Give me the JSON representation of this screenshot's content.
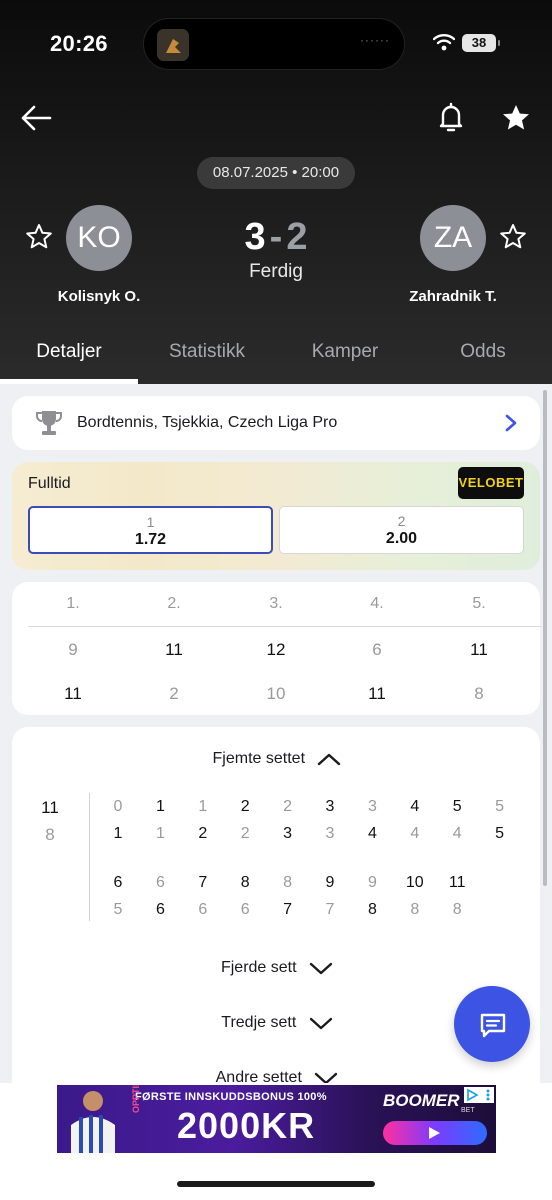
{
  "status_bar": {
    "time": "20:26",
    "battery": "38",
    "island_dots": "······"
  },
  "match": {
    "date": "08.07.2025 • 20:00",
    "home": {
      "initials": "KO",
      "name": "Kolisnyk O.",
      "score": "3"
    },
    "away": {
      "initials": "ZA",
      "name": "Zahradnik T.",
      "score": "2"
    },
    "dash": "-",
    "status": "Ferdig"
  },
  "tabs": [
    {
      "label": "Detaljer",
      "active": true
    },
    {
      "label": "Statistikk"
    },
    {
      "label": "Kamper"
    },
    {
      "label": "Odds"
    }
  ],
  "league": {
    "label": "Bordtennis, Tsjekkia, Czech Liga Pro"
  },
  "odds": {
    "title": "Fulltid",
    "bookmaker": "VELOBET",
    "home": {
      "label": "1",
      "value": "1.72"
    },
    "away": {
      "label": "2",
      "value": "2.00"
    }
  },
  "sets": {
    "headers": [
      "1.",
      "2.",
      "3.",
      "4.",
      "5."
    ],
    "home": [
      "9",
      "11",
      "12",
      "6",
      "11"
    ],
    "away": [
      "11",
      "2",
      "10",
      "11",
      "8"
    ]
  },
  "detail": {
    "current_set": "Fjemte settet",
    "final": {
      "home": "11",
      "away": "8"
    },
    "rows": [
      {
        "home": [
          "0",
          "1",
          "1",
          "2",
          "2",
          "3",
          "3",
          "4",
          "5",
          "5"
        ],
        "away": [
          "1",
          "1",
          "2",
          "2",
          "3",
          "3",
          "4",
          "4",
          "4",
          "5"
        ]
      },
      {
        "home": [
          "6",
          "6",
          "7",
          "8",
          "8",
          "9",
          "9",
          "10",
          "11"
        ],
        "away": [
          "5",
          "6",
          "6",
          "6",
          "7",
          "7",
          "8",
          "8",
          "8"
        ]
      }
    ],
    "other_sets": [
      "Fjerde sett",
      "Tredje sett",
      "Andre settet"
    ]
  },
  "ad": {
    "top_text": "FØRSTE INNSKUDDSBONUS 100%",
    "amount": "2000KR",
    "side_text": "OPPTIL",
    "brand": "BOOMER",
    "brand_sub": "BET"
  },
  "colors": {
    "accent": "#3c53e4",
    "selected_border": "#3b4bb8",
    "bookmaker_text": "#f3d21b"
  }
}
